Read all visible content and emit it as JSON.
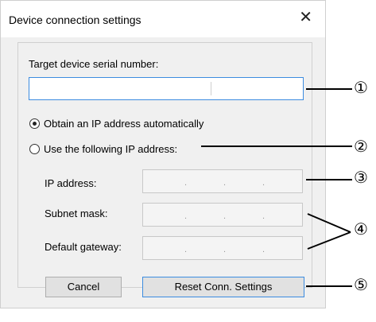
{
  "dialog": {
    "title": "Device connection settings",
    "close_glyph": "✕",
    "serial_label": "Target device serial number:",
    "serial_value": "",
    "radio_auto": "Obtain an IP address automatically",
    "radio_manual": "Use the following IP address:",
    "ip_label": "IP address:",
    "subnet_label": "Subnet mask:",
    "gateway_label": "Default gateway:",
    "ip_dot": ".",
    "cancel_label": "Cancel",
    "reset_label": "Reset Conn. Settings"
  },
  "callouts": [
    "①",
    "②",
    "③",
    "④",
    "⑤"
  ]
}
